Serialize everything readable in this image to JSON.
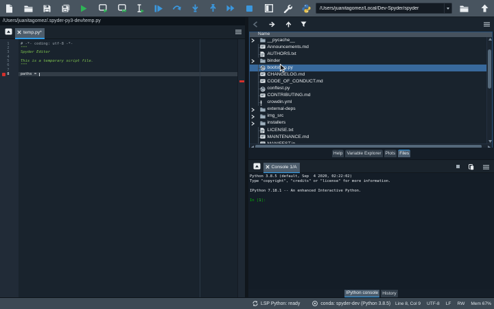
{
  "accent_color": "#2f9dea",
  "selection_color": "#38699c",
  "toolbar": {
    "buttons": [
      {
        "name": "new-file",
        "icon": "doc-new"
      },
      {
        "name": "open-file",
        "icon": "folder-open"
      },
      {
        "name": "save",
        "icon": "floppy"
      },
      {
        "name": "save-all",
        "icon": "floppy-all"
      },
      {
        "name": "run-file",
        "icon": "play"
      },
      {
        "name": "run-cell",
        "icon": "cell-play"
      },
      {
        "name": "run-cell-advance",
        "icon": "cell-play-adv"
      },
      {
        "name": "run-selection",
        "icon": "ibeam-play"
      },
      {
        "name": "debug-file",
        "icon": "debug-play"
      },
      {
        "name": "step-over",
        "icon": "arc-arrow"
      },
      {
        "name": "step-into",
        "icon": "arrow-down-bar"
      },
      {
        "name": "step-out",
        "icon": "arrow-up-bar"
      },
      {
        "name": "continue-execution",
        "icon": "fast-forward"
      },
      {
        "name": "stop-debug",
        "icon": "stop-square"
      },
      {
        "name": "maximize-pane",
        "icon": "maximize"
      },
      {
        "name": "preferences",
        "icon": "wrench"
      },
      {
        "name": "python-env",
        "icon": "python-logo"
      }
    ],
    "working_directory": "/Users/juanitagomez/Local/Dev-Spyder/spyder",
    "browse_directory_icon": "folder-open",
    "parent_directory_icon": "arrow-up-fat"
  },
  "editor": {
    "file_path": "/Users/juanitagomez/.spyder-py3-dev/temp.py",
    "tab_label": "temp.py*",
    "lines": [
      {
        "n": "1",
        "text": "# -*- coding: utf-8 -*-",
        "cls": "comment"
      },
      {
        "n": "2",
        "text": "\"\"\"",
        "cls": "docstring"
      },
      {
        "n": "3",
        "text": "Spyder Editor",
        "cls": "docstring it"
      },
      {
        "n": "4",
        "text": "",
        "cls": ""
      },
      {
        "n": "5",
        "text": "This is a temporary script file.",
        "cls": "docstring it"
      },
      {
        "n": "6",
        "text": "\"\"\"",
        "cls": "docstring"
      },
      {
        "n": "7",
        "text": "",
        "cls": ""
      },
      {
        "n": "8",
        "text": "paths = ",
        "cls": "",
        "current": true
      }
    ]
  },
  "files_pane": {
    "toolbar_icons": [
      "arrow-left",
      "arrow-right",
      "arrow-up",
      "filter-funnel"
    ],
    "header": "Name",
    "rows": [
      {
        "name": "__pycache__",
        "type": "folder",
        "expandable": true
      },
      {
        "name": "Announcements.md",
        "type": "md"
      },
      {
        "name": "AUTHORS.txt",
        "type": "txt"
      },
      {
        "name": "binder",
        "type": "folder",
        "expandable": true
      },
      {
        "name": "bootstrap.py",
        "type": "py",
        "selected": true
      },
      {
        "name": "CHANGELOG.md",
        "type": "md"
      },
      {
        "name": "CODE_OF_CONDUCT.md",
        "type": "md"
      },
      {
        "name": "conftest.py",
        "type": "py"
      },
      {
        "name": "CONTRIBUTING.md",
        "type": "md"
      },
      {
        "name": "crowdin.yml",
        "type": "yml"
      },
      {
        "name": "external-deps",
        "type": "folder",
        "expandable": true
      },
      {
        "name": "img_src",
        "type": "folder",
        "expandable": true
      },
      {
        "name": "installers",
        "type": "folder",
        "expandable": true
      },
      {
        "name": "LICENSE.txt",
        "type": "txt"
      },
      {
        "name": "MAINTENANCE.md",
        "type": "md"
      },
      {
        "name": "MANIFEST.in",
        "type": "md"
      }
    ]
  },
  "pane_tabs": [
    {
      "label": "Help",
      "selected": false
    },
    {
      "label": "Variable Explorer",
      "selected": false
    },
    {
      "label": "Plots",
      "selected": false
    },
    {
      "label": "Files",
      "selected": true
    }
  ],
  "console": {
    "tab_label": "Console 1/A",
    "lines": [
      "Python 3.8.5 (default, Sep  4 2020, 02:22:02)",
      "Type \"copyright\", \"credits\" or \"license\" for more information.",
      "",
      "IPython 7.18.1 -- An enhanced Interactive Python.",
      ""
    ],
    "prompt_open": "In [",
    "prompt_num": "1",
    "prompt_close": "]: "
  },
  "console_tabs": [
    {
      "label": "IPython console",
      "selected": true
    },
    {
      "label": "History",
      "selected": false
    }
  ],
  "statusbar": {
    "left": [
      {
        "icon": "lsp-refresh",
        "label": "LSP Python: ready"
      },
      {
        "icon": "conda-circle",
        "label": "conda: spyder-dev (Python 3.8.5)"
      }
    ],
    "right": [
      "Line 8, Col 9",
      "UTF-8",
      "LF",
      "RW",
      "Mem 67%"
    ]
  }
}
